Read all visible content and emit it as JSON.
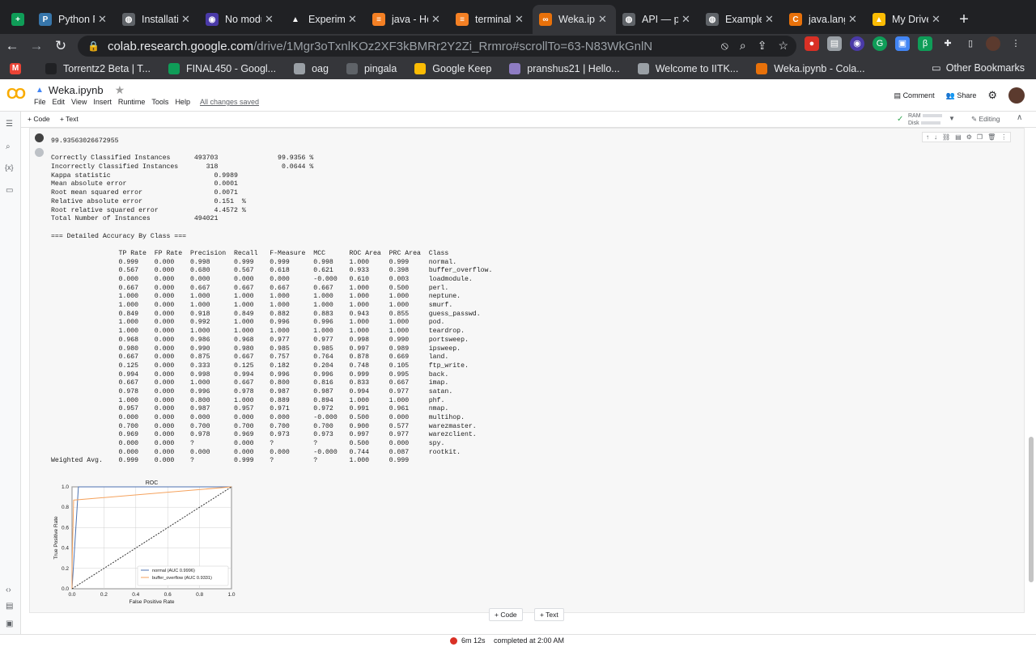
{
  "browser": {
    "tabs": [
      {
        "title": "",
        "color": "#0f9d58",
        "glyph": "+"
      },
      {
        "title": "Python R",
        "color": "#3776ab",
        "glyph": "P"
      },
      {
        "title": "Installatio",
        "color": "#5f6368",
        "glyph": "◍"
      },
      {
        "title": "No modu",
        "color": "#4a3aa8",
        "glyph": "◉"
      },
      {
        "title": "Experime",
        "color": "#202124",
        "glyph": "▲"
      },
      {
        "title": "java - Ho",
        "color": "#f48024",
        "glyph": "≡"
      },
      {
        "title": "terminal",
        "color": "#f48024",
        "glyph": "≡"
      },
      {
        "title": "Weka.ipy",
        "color": "#e8710a",
        "glyph": "∞"
      },
      {
        "title": "API — py",
        "color": "#5f6368",
        "glyph": "◍"
      },
      {
        "title": "Example",
        "color": "#5f6368",
        "glyph": "◍"
      },
      {
        "title": "java.lang",
        "color": "#e8710a",
        "glyph": "C"
      },
      {
        "title": "My Drive",
        "color": "#fbbc04",
        "glyph": "▲"
      }
    ],
    "url_host": "colab.research.google.com",
    "url_path": "/drive/1Mgr3oTxnlKOz2XF3kBMRr2Y2Zi_Rrmro#scrollTo=63-N83WkGnlN",
    "bookmarks": [
      {
        "label": "",
        "color": "#ea4335",
        "glyph": "M"
      },
      {
        "label": "Torrentz2 Beta | T...",
        "color": "#202124"
      },
      {
        "label": "FINAL450 - Googl...",
        "color": "#0f9d58"
      },
      {
        "label": "oag",
        "color": "#9aa0a6"
      },
      {
        "label": "pingala",
        "color": "#5f6368"
      },
      {
        "label": "Google Keep",
        "color": "#fbbc04"
      },
      {
        "label": "pranshus21 | Hello...",
        "color": "#8e7cc3"
      },
      {
        "label": "Welcome to IITK...",
        "color": "#9aa0a6"
      },
      {
        "label": "Weka.ipynb - Cola...",
        "color": "#e8710a"
      }
    ],
    "other_bookmarks": "Other Bookmarks"
  },
  "colab": {
    "filename": "Weka.ipynb",
    "menu": [
      "File",
      "Edit",
      "View",
      "Insert",
      "Runtime",
      "Tools",
      "Help"
    ],
    "saved": "All changes saved",
    "comment": "Comment",
    "share": "Share",
    "add_code": "+ Code",
    "add_text": "+ Text",
    "ram": "RAM",
    "disk": "Disk",
    "editing": "Editing"
  },
  "output": {
    "accuracy_line": "99.93563026672955",
    "summary": [
      "Correctly Classified Instances      493703               99.9356 %",
      "Incorrectly Classified Instances       318                0.0644 %",
      "Kappa statistic                          0.9989",
      "Mean absolute error                      0.0001",
      "Root mean squared error                  0.0071",
      "Relative absolute error                  0.151  %",
      "Root relative squared error              4.4572 %",
      "Total Number of Instances           494021"
    ],
    "detail_header": "=== Detailed Accuracy By Class ===",
    "table_header": "                 TP Rate  FP Rate  Precision  Recall   F-Measure  MCC      ROC Area  PRC Area  Class",
    "table_rows": [
      "                 0.999    0.000    0.998      0.999    0.999      0.998    1.000     0.999     normal.",
      "                 0.567    0.000    0.680      0.567    0.618      0.621    0.933     0.398     buffer_overflow.",
      "                 0.000    0.000    0.000      0.000    0.000      -0.000   0.610     0.003     loadmodule.",
      "                 0.667    0.000    0.667      0.667    0.667      0.667    1.000     0.500     perl.",
      "                 1.000    0.000    1.000      1.000    1.000      1.000    1.000     1.000     neptune.",
      "                 1.000    0.000    1.000      1.000    1.000      1.000    1.000     1.000     smurf.",
      "                 0.849    0.000    0.918      0.849    0.882      0.883    0.943     0.855     guess_passwd.",
      "                 1.000    0.000    0.992      1.000    0.996      0.996    1.000     1.000     pod.",
      "                 1.000    0.000    1.000      1.000    1.000      1.000    1.000     1.000     teardrop.",
      "                 0.968    0.000    0.986      0.968    0.977      0.977    0.998     0.990     portsweep.",
      "                 0.980    0.000    0.990      0.980    0.985      0.985    0.997     0.989     ipsweep.",
      "                 0.667    0.000    0.875      0.667    0.757      0.764    0.878     0.669     land.",
      "                 0.125    0.000    0.333      0.125    0.182      0.204    0.748     0.105     ftp_write.",
      "                 0.994    0.000    0.998      0.994    0.996      0.996    0.999     0.995     back.",
      "                 0.667    0.000    1.000      0.667    0.800      0.816    0.833     0.667     imap.",
      "                 0.978    0.000    0.996      0.978    0.987      0.987    0.994     0.977     satan.",
      "                 1.000    0.000    0.800      1.000    0.889      0.894    1.000     1.000     phf.",
      "                 0.957    0.000    0.987      0.957    0.971      0.972    0.991     0.961     nmap.",
      "                 0.000    0.000    0.000      0.000    0.000      -0.000   0.500     0.000     multihop.",
      "                 0.700    0.000    0.700      0.700    0.700      0.700    0.900     0.577     warezmaster.",
      "                 0.969    0.000    0.978      0.969    0.973      0.973    0.997     0.977     warezclient.",
      "                 0.000    0.000    ?          0.000    ?          ?        0.500     0.000     spy.",
      "                 0.000    0.000    0.000      0.000    0.000      -0.000   0.744     0.087     rootkit.",
      "Weighted Avg.    0.999    0.000    ?          0.999    ?          ?        1.000     0.999"
    ]
  },
  "chart_data": {
    "type": "line",
    "title": "ROC",
    "xlabel": "False Positive Rate",
    "ylabel": "True Positive Rate",
    "xlim": [
      0.0,
      1.0
    ],
    "ylim": [
      0.0,
      1.0
    ],
    "xticks": [
      "0.0",
      "0.2",
      "0.4",
      "0.6",
      "0.8",
      "1.0"
    ],
    "yticks": [
      "0.0",
      "0.2",
      "0.4",
      "0.6",
      "0.8",
      "1.0"
    ],
    "grid": true,
    "legend_position": "bottom-right",
    "series": [
      {
        "name": "normal  (AUC  0.9996)",
        "color": "#4c72b0",
        "x": [
          0.0,
          0.0,
          0.04,
          1.0
        ],
        "y": [
          0.0,
          0.0,
          1.0,
          1.0
        ]
      },
      {
        "name": "buffer_overflow  (AUC  0.9331)",
        "color": "#f5a25d",
        "x": [
          0.0,
          0.0,
          0.01,
          1.0
        ],
        "y": [
          0.0,
          0.2,
          0.87,
          1.0
        ]
      },
      {
        "name": "",
        "color": "#333333",
        "dashed": true,
        "x": [
          0.0,
          1.0
        ],
        "y": [
          0.0,
          1.0
        ]
      }
    ]
  },
  "footer": {
    "add_code": "+ Code",
    "add_text": "+ Text",
    "elapsed": "6m 12s",
    "completed": "completed at 2:00 AM"
  }
}
